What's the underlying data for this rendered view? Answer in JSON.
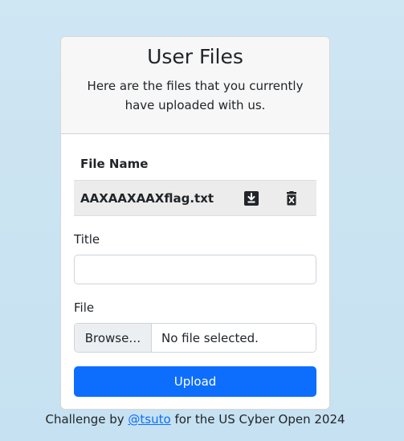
{
  "card": {
    "title": "User Files",
    "subtitle": "Here are the files that you currently have uploaded with us."
  },
  "table": {
    "header": "File Name",
    "rows": [
      {
        "name": "AAXAAXAAXflag.txt",
        "download_icon": "download-icon",
        "delete_icon": "delete-icon"
      }
    ]
  },
  "form": {
    "title_label": "Title",
    "title_value": "",
    "file_label": "File",
    "browse_label": "Browse…",
    "file_status": "No file selected.",
    "upload_label": "Upload"
  },
  "footer": {
    "prefix": "Challenge by ",
    "link_text": "@tsuto",
    "suffix": " for the US Cyber Open 2024"
  },
  "colors": {
    "background": "#cfe6f3",
    "accent": "#0d6efd"
  }
}
